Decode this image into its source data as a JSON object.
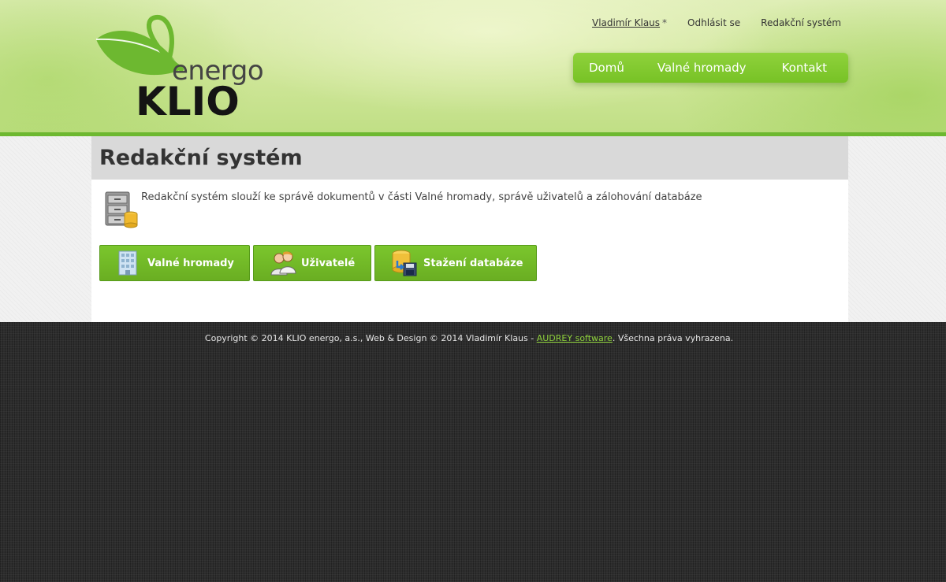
{
  "logo": {
    "line1": "energo",
    "line2": "KLIO"
  },
  "top_links": {
    "user": "Vladimír Klaus",
    "user_marker": "*",
    "logout": "Odhlásit se",
    "cms": "Redakční systém"
  },
  "nav": {
    "items": [
      "Domů",
      "Valné hromady",
      "Kontakt"
    ]
  },
  "page": {
    "title": "Redakční systém",
    "description": "Redakční systém slouží ke správě dokumentů v části Valné hromady, správě uživatelů a zálohování databáze",
    "buttons": [
      "Valné hromady",
      "Uživatelé",
      "Stažení databáze"
    ]
  },
  "footer": {
    "text_before": "Copyright © 2014 KLIO energo, a.s., Web & Design © 2014 Vladimír Klaus - ",
    "link": "AUDREY software",
    "text_after": ". Všechna práva vyhrazena."
  },
  "colors": {
    "accent": "#77c225",
    "header_stripe": "#6db830",
    "footer_bg": "#2d2d2d",
    "footer_link": "#8fd23c"
  }
}
